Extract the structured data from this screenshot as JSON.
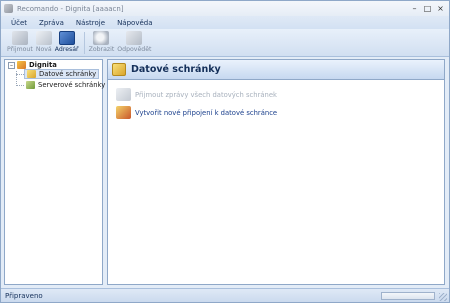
{
  "window": {
    "title": "Recomando - Dignita [aaaacn]",
    "controls": {
      "minimize": "–",
      "maximize": "□",
      "close": "×"
    }
  },
  "menu": {
    "items": [
      "Účet",
      "Zpráva",
      "Nástroje",
      "Nápověda"
    ]
  },
  "toolbar": {
    "buttons": [
      {
        "label": "Přijmout",
        "icon": "receive-icon",
        "enabled": false
      },
      {
        "label": "Nová",
        "icon": "new-message-icon",
        "enabled": false
      },
      {
        "label": "Adresář",
        "icon": "address-book-icon",
        "enabled": true
      },
      {
        "label": "Zobrazit",
        "icon": "view-icon",
        "enabled": false
      },
      {
        "label": "Odpovědět",
        "icon": "reply-icon",
        "enabled": false
      }
    ]
  },
  "tree": {
    "root": {
      "label": "Dignita",
      "toggle": "–",
      "icon": "account-icon"
    },
    "children": [
      {
        "label": "Datové schránky",
        "icon": "databox-folder-icon",
        "selected": true
      },
      {
        "label": "Serverové schránky",
        "icon": "server-folder-icon",
        "selected": false
      }
    ]
  },
  "content": {
    "header_title": "Datové schránky",
    "header_icon": "databox-icon",
    "actions": [
      {
        "label": "Přijmout zprávy všech datových schránek",
        "icon": "receive-all-icon",
        "enabled": false
      },
      {
        "label": "Vytvořit nové připojení k datové schránce",
        "icon": "new-connection-icon",
        "enabled": true
      }
    ]
  },
  "status": {
    "text": "Připraveno"
  }
}
